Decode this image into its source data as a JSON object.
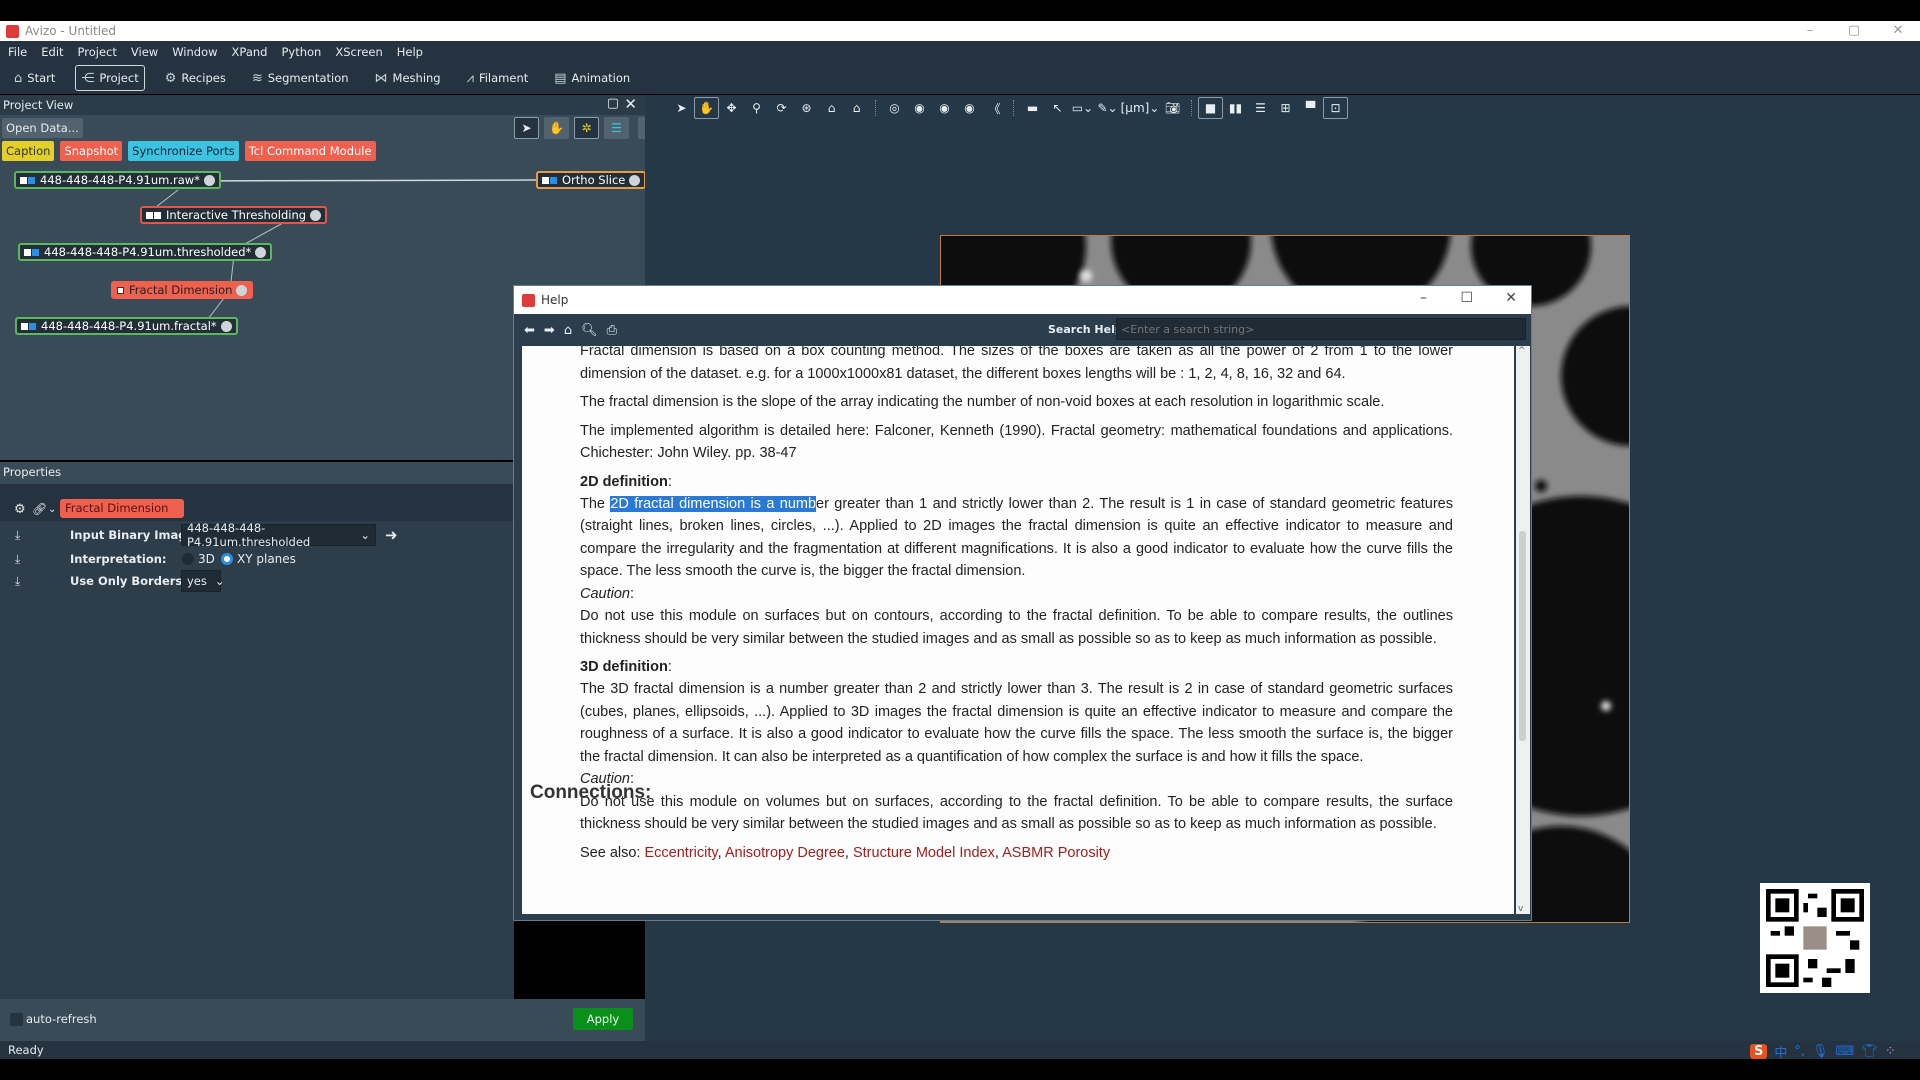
{
  "app": {
    "title": "Avizo - Untitled",
    "logo": "Av"
  },
  "menu": [
    "File",
    "Edit",
    "Project",
    "View",
    "Window",
    "XPand",
    "Python",
    "XScreen",
    "Help"
  ],
  "workrooms": [
    {
      "label": "Start",
      "icon": "home-icon"
    },
    {
      "label": "Project",
      "icon": "project-tree-icon",
      "active": true
    },
    {
      "label": "Recipes",
      "icon": "gears-icon"
    },
    {
      "label": "Segmentation",
      "icon": "layers-icon"
    },
    {
      "label": "Meshing",
      "icon": "mesh-icon"
    },
    {
      "label": "Filament",
      "icon": "filament-icon"
    },
    {
      "label": "Animation",
      "icon": "film-icon"
    }
  ],
  "project_view": {
    "title": "Project View",
    "open_data": "Open Data...",
    "quick_buttons": [
      {
        "label": "Caption",
        "color": "#e3cf2a"
      },
      {
        "label": "Snapshot",
        "color": "#f0604f"
      },
      {
        "label": "Synchronize Ports",
        "color": "#3cc3e0"
      },
      {
        "label": "Tcl Command Module",
        "color": "#f0604f"
      }
    ],
    "nodes": [
      {
        "label": "448-448-448-P4.91um.raw*",
        "type": "data",
        "color": "#5cb85c"
      },
      {
        "label": "Ortho Slice",
        "type": "display",
        "color": "#e89a4a"
      },
      {
        "label": "Interactive Thresholding",
        "type": "compute",
        "color": "#e0564a"
      },
      {
        "label": "448-448-448-P4.91um.thresholded*",
        "type": "data",
        "color": "#5cb85c"
      },
      {
        "label": "Fractal Dimension",
        "type": "measure",
        "color": "#f0604f"
      },
      {
        "label": "448-448-448-P4.91um.fractal*",
        "type": "data",
        "color": "#5cb85c"
      }
    ]
  },
  "properties": {
    "title": "Properties",
    "module": "Fractal Dimension",
    "fields": [
      {
        "label": "Input Binary Image:",
        "value": "448-448-448-P4.91um.thresholded"
      },
      {
        "label": "Interpretation:",
        "options": [
          "3D",
          "XY planes"
        ],
        "selected": "XY planes"
      },
      {
        "label": "Use Only Borders:",
        "value": "yes"
      }
    ],
    "auto_refresh": "auto-refresh",
    "auto_refresh_checked": false,
    "apply": "Apply"
  },
  "viewer_toolbar": {
    "unit": "[µm]"
  },
  "help": {
    "title": "Help",
    "search_label": "Search Help:",
    "search_placeholder": "<Enter a search string>",
    "p1": "Fractal dimension is based on a box counting method. The sizes of the boxes are taken as all the power of 2 from 1 to the lower dimension of the dataset. e.g. for a 1000x1000x81 dataset, the different boxes lengths will be : 1, 2, 4, 8, 16, 32 and 64.",
    "p2": "The fractal dimension is the slope of the array indicating the number of non-void boxes at each resolution in logarithmic scale.",
    "p3": "The implemented algorithm is detailed here: Falconer, Kenneth (1990). Fractal geometry: mathematical foundations and applications. Chichester: John Wiley. pp. 38-47",
    "h2d": "2D definition",
    "d2_pre": "The ",
    "d2_sel": "2D fractal dimension is a numb",
    "d2_post": "er greater than 1 and strictly lower than 2. The result is 1 in case of standard geometric features (straight lines, broken lines, circles, ...). Applied to 2D images the fractal dimension is quite an effective indicator to measure and compare the irregularity and the fragmentation at different magnifications. It is also a good indicator to evaluate how the curve fills the space. The less smooth the curve is, the bigger the fractal dimension.",
    "caution": "Caution",
    "c2": "Do not use this module on surfaces but on contours, according to the fractal definition. To be able to compare results, the outlines thickness should be very similar between the studied images and as small as possible so as to keep as much information as possible.",
    "h3d": "3D definition",
    "d3": "The 3D fractal dimension is a number greater than 2 and strictly lower than 3. The result is 2 in case of standard geometric surfaces (cubes, planes, ellipsoids, ...). Applied to 3D images the fractal dimension is quite an effective indicator to measure and compare the roughness of a surface. It is also a good indicator to evaluate how the curve fills the space. The less smooth the surface is, the bigger the fractal dimension. It can also be interpreted as a quantification of how complex the surface is and how it fills the space.",
    "c3": "Do not use this module on volumes but on surfaces, according to the fractal definition. To be able to compare results, the surface thickness should be very similar between the studied images and as small as possible so as to keep as much information as possible.",
    "see_also": "See also:",
    "links": [
      "Eccentricity",
      "Anisotropy Degree",
      "Structure Model Index",
      "ASBMR Porosity"
    ],
    "connections": "Connections:"
  },
  "status": "Ready",
  "tray": {
    "ime": "中",
    "punct": "°,"
  }
}
